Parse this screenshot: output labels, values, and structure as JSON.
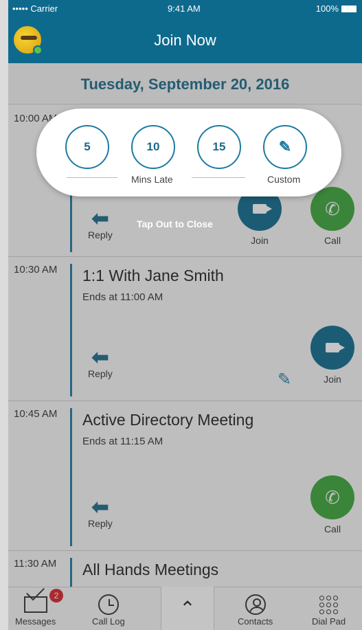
{
  "status": {
    "carrier": "••••• Carrier",
    "time": "9:41 AM",
    "battery": "100%"
  },
  "header": {
    "title": "Join Now"
  },
  "date": "Tuesday, September 20, 2016",
  "meetings": [
    {
      "time": "10:00 AM",
      "title": "",
      "ends": "",
      "reply": "Reply",
      "join": "Join",
      "call": "Call"
    },
    {
      "time": "10:30 AM",
      "title": "1:1 With Jane Smith",
      "ends": "Ends at 11:00 AM",
      "reply": "Reply",
      "join": "Join"
    },
    {
      "time": "10:45 AM",
      "title": "Active Directory Meeting",
      "ends": "Ends at 11:15 AM",
      "reply": "Reply",
      "call": "Call"
    },
    {
      "time": "11:30 AM",
      "title": "All Hands Meetings"
    }
  ],
  "overlay": {
    "tap_out": "Tap Out to Close"
  },
  "popup": {
    "opt1": "5",
    "opt2": "10",
    "opt3": "15",
    "mins_late": "Mins Late",
    "custom": "Custom"
  },
  "tabbar": {
    "messages": "Messages",
    "messages_badge": "2",
    "call_log": "Call Log",
    "contacts": "Contacts",
    "dial_pad": "Dial Pad"
  },
  "colors": {
    "brand": "#0e6a8d",
    "accent": "#1c7aa3",
    "call_green": "#3aa53a",
    "badge_red": "#d9232d"
  }
}
